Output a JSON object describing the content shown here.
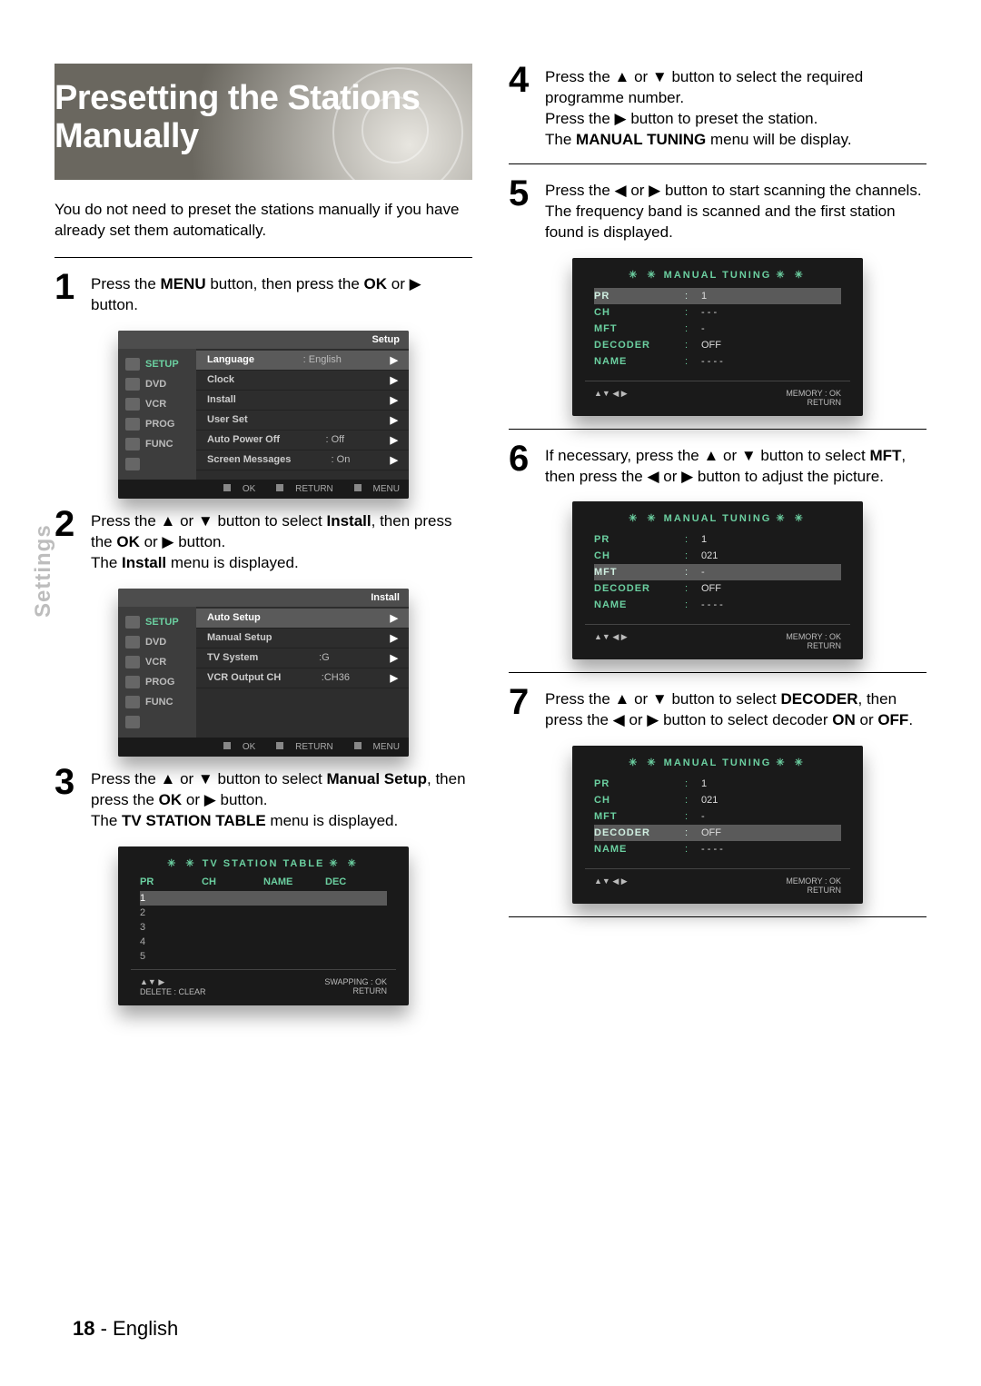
{
  "sideTab": "Settings",
  "title": "Presetting the Stations Manually",
  "intro": "You do not need to preset the stations manually if you have already set them automatically.",
  "footer": {
    "page": "18",
    "sep": " - ",
    "lang": "English"
  },
  "steps": {
    "s1": {
      "num": "1",
      "a": "Press the ",
      "b1": "MENU",
      "c": " button, then press the ",
      "b2": "OK",
      "d": " or ▶ button."
    },
    "s2": {
      "num": "2",
      "a": "Press the ▲ or ▼ button to select ",
      "b1": "Install",
      "c": ", then press the ",
      "b2": "OK",
      "d": " or ▶ button.",
      "e": "The ",
      "b3": "Install",
      "f": " menu is displayed."
    },
    "s3": {
      "num": "3",
      "a": "Press the ▲ or ▼ button to select ",
      "b1": "Manual Setup",
      "c": ", then press the ",
      "b2": "OK",
      "d": " or ▶ button.",
      "e": "The ",
      "b3": "TV STATION TABLE",
      "f": " menu is displayed."
    },
    "s4": {
      "num": "4",
      "a": "Press the ▲ or ▼ button to select the required programme number.",
      "b": "Press the ▶ button to preset the station.",
      "c": "The ",
      "b1": "MANUAL TUNING",
      "d": " menu will be display."
    },
    "s5": {
      "num": "5",
      "a": "Press the ◀ or ▶ button to start scanning the channels.",
      "b": "The frequency band is scanned and the first station found is displayed."
    },
    "s6": {
      "num": "6",
      "a": "If necessary, press the ▲ or ▼ button to select ",
      "b1": "MFT",
      "c": ", then press the ◀ or ▶ button to adjust the picture."
    },
    "s7": {
      "num": "7",
      "a": "Press the ▲ or ▼ button to select ",
      "b1": "DECODER",
      "c": ", then press the ◀ or ▶ button to select decoder ",
      "b2": "ON",
      "d": " or ",
      "b3": "OFF",
      "e": "."
    }
  },
  "osd1": {
    "header": "Setup",
    "nav": [
      "SETUP",
      "DVD",
      "VCR",
      "PROG",
      "FUNC"
    ],
    "rows": [
      {
        "label": "Language",
        "val": ": English",
        "hl": true
      },
      {
        "label": "Clock",
        "val": ""
      },
      {
        "label": "Install",
        "val": ""
      },
      {
        "label": "User Set",
        "val": ""
      },
      {
        "label": "Auto Power Off",
        "val": ": Off"
      },
      {
        "label": "Screen Messages",
        "val": ": On"
      }
    ],
    "foot": {
      "ok": "OK",
      "ret": "RETURN",
      "menu": "MENU"
    }
  },
  "osd2": {
    "header": "Install",
    "nav": [
      "SETUP",
      "DVD",
      "VCR",
      "PROG",
      "FUNC"
    ],
    "rows": [
      {
        "label": "Auto Setup",
        "val": "",
        "hl": true
      },
      {
        "label": "Manual Setup",
        "val": ""
      },
      {
        "label": "TV System",
        "val": ":G"
      },
      {
        "label": "VCR Output CH",
        "val": ":CH36"
      }
    ],
    "foot": {
      "ok": "OK",
      "ret": "RETURN",
      "menu": "MENU"
    }
  },
  "station": {
    "title": "TV  STATION  TABLE",
    "cols": [
      "PR",
      "CH",
      "NAME",
      "DEC"
    ],
    "rows": [
      "1",
      "2",
      "3",
      "4",
      "5"
    ],
    "footL1": "▲▼  ▶",
    "footL2": "DELETE : CLEAR",
    "footR1": "SWAPPING : OK",
    "footR2": "RETURN"
  },
  "tune1": {
    "title": "MANUAL TUNING",
    "kv": [
      {
        "k": "PR",
        "v": "1",
        "hl": true
      },
      {
        "k": "CH",
        "v": "- - -"
      },
      {
        "k": "MFT",
        "v": "-"
      },
      {
        "k": "DECODER",
        "v": "OFF"
      },
      {
        "k": "NAME",
        "v": "- - - -"
      }
    ],
    "footL": "▲▼  ◀ ▶",
    "footR1": "MEMORY : OK",
    "footR2": "RETURN"
  },
  "tune2": {
    "title": "MANUAL TUNING",
    "kv": [
      {
        "k": "PR",
        "v": "1"
      },
      {
        "k": "CH",
        "v": "021"
      },
      {
        "k": "MFT",
        "v": "-",
        "hl": true
      },
      {
        "k": "DECODER",
        "v": "OFF"
      },
      {
        "k": "NAME",
        "v": "- - - -"
      }
    ],
    "footL": "▲▼  ◀ ▶",
    "footR1": "MEMORY : OK",
    "footR2": "RETURN"
  },
  "tune3": {
    "title": "MANUAL TUNING",
    "kv": [
      {
        "k": "PR",
        "v": "1"
      },
      {
        "k": "CH",
        "v": "021"
      },
      {
        "k": "MFT",
        "v": "-"
      },
      {
        "k": "DECODER",
        "v": "OFF",
        "hl": true
      },
      {
        "k": "NAME",
        "v": "- - - -"
      }
    ],
    "footL": "▲▼  ◀ ▶",
    "footR1": "MEMORY : OK",
    "footR2": "RETURN"
  }
}
